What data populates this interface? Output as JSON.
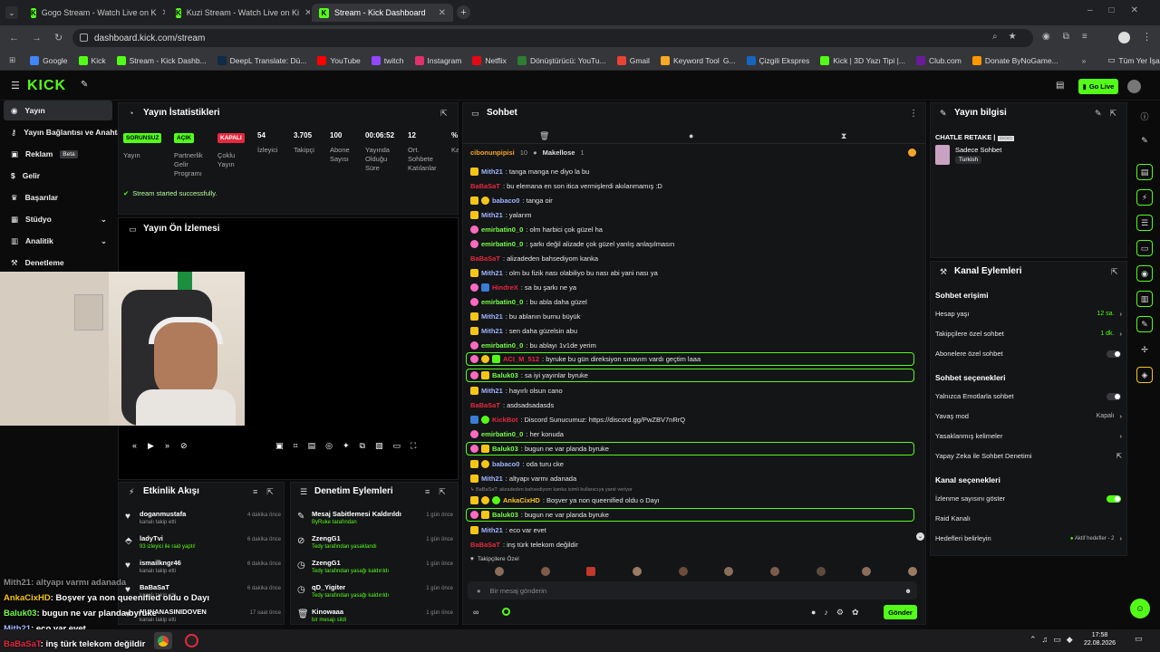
{
  "browser": {
    "tabs": [
      {
        "title": "Gogo Stream - Watch Live on K"
      },
      {
        "title": "Kuzi Stream - Watch Live on Ki"
      },
      {
        "title": "Stream - Kick Dashboard"
      }
    ],
    "url": "dashboard.kick.com/stream",
    "bookmarks": [
      "Google",
      "Kick",
      "Stream - Kick Dashb...",
      "DeepL Translate: Dü...",
      "YouTube",
      "twitch",
      "Instagram",
      "Netflix",
      "Dönüştürücü: YouTu...",
      "Gmail",
      "Keyword Tool",
      "G...",
      "Çizgili Ekspres",
      "Kick | 3D Yazı Tipi |...",
      "Club.com",
      "Donate ByNoGame..."
    ],
    "all_bookmarks": "Tüm Yer İşaretleri"
  },
  "header": {
    "logo": "KICK",
    "go_live": "Go Live"
  },
  "sidebar": {
    "items": [
      {
        "label": "Yayın"
      },
      {
        "label": "Yayın Bağlantısı ve Anahtarı"
      },
      {
        "label": "Reklam",
        "badge": "Beta"
      },
      {
        "label": "Gelir"
      },
      {
        "label": "Başarılar"
      },
      {
        "label": "Stüdyo"
      },
      {
        "label": "Analitik"
      },
      {
        "label": "Denetleme"
      }
    ]
  },
  "stats": {
    "title": "Yayın İstatistikleri",
    "badges": [
      {
        "text": "SORUNSUZ",
        "label": "Yayın",
        "color": "#53fc18"
      },
      {
        "text": "AÇIK",
        "label": "Partnerlik Gelir Programı",
        "color": "#53fc18"
      },
      {
        "text": "KAPALI",
        "label": "Çoklu Yayın",
        "color": "#e5293f"
      }
    ],
    "values": [
      {
        "value": "54",
        "label": "İzleyici"
      },
      {
        "value": "3.705",
        "label": "Takipçi"
      },
      {
        "value": "100",
        "label": "Abone Sayısı"
      },
      {
        "value": "00:06:52",
        "label": "Yayında Olduğu Süre"
      },
      {
        "value": "12",
        "label": "Ort. Sohbete Katılanlar"
      },
      {
        "value": "%",
        "label": "Ka"
      }
    ],
    "success": "Stream started successfully."
  },
  "preview": {
    "title": "Yayın Ön İzlemesi"
  },
  "activity": {
    "title": "Etkinlik Akışı",
    "rows": [
      {
        "name": "doganmustafa",
        "sub": "kanalı takip etti",
        "time": "4 dakika önce"
      },
      {
        "name": "ladyTvi",
        "sub": "93 izleyici ile raid yaptı!",
        "time": "6 dakika önce"
      },
      {
        "name": "ismailkngr46",
        "sub": "kanalı takip etti",
        "time": "6 dakika önce"
      },
      {
        "name": "BaBaSaT",
        "sub": "kanalı takip etti",
        "time": "6 dakika önce"
      },
      {
        "name": "NUNANASINIDOVEN",
        "sub": "kanalı takip etti",
        "time": "17 saat önce"
      }
    ]
  },
  "moderation": {
    "title": "Denetim Eylemleri",
    "rows": [
      {
        "name": "Mesaj Sabitlemesi Kaldırıldı",
        "sub": "ByRuke tarafından",
        "time": "1 gün önce"
      },
      {
        "name": "ZzengG1",
        "sub": "Tedy tarafından yasaklandı",
        "time": "1 gün önce"
      },
      {
        "name": "ZzengG1",
        "sub": "Tedy tarafından yasağı kaldırıldı",
        "time": "1 gün önce"
      },
      {
        "name": "qD_Yigiter",
        "sub": "Tedy tarafından yasağı kaldırıldı",
        "time": "1 gün önce"
      },
      {
        "name": "Kinowaaa",
        "sub": "bir mesajı sildi",
        "time": "1 gün önce"
      }
    ]
  },
  "chat": {
    "title": "Sohbet",
    "pinned": {
      "user1": "cibonunpipisi",
      "count1": "10",
      "user2": "Makellose",
      "count2": "1"
    },
    "messages": [
      {
        "user": "Mith21",
        "text": ": tanga manga ne diyo la bu",
        "color": "#9fb4ff"
      },
      {
        "user": "BaBaSaT",
        "text": ": bu elemana en son itica vermişlerdi akılanmamış :D",
        "color": "#e5293f"
      },
      {
        "user": "babaco0",
        "text": ": tanga oir",
        "color": "#9fb4ff"
      },
      {
        "user": "Mith21",
        "text": ": yalarım",
        "color": "#9fb4ff"
      },
      {
        "user": "emirbatin0_0",
        "text": ": olm harbici çok güzel ha",
        "color": "#75fd46"
      },
      {
        "user": "emirbatin0_0",
        "text": ": şarkı değil alizade çok güzel yanlış anlaşılmasın",
        "color": "#75fd46"
      },
      {
        "user": "BaBaSaT",
        "text": ": alizadeden bahsediyom kanka",
        "color": "#e5293f"
      },
      {
        "user": "Mith21",
        "text": ": olm bu fizik nası olabiliyo bu nası abi yani nası ya",
        "color": "#9fb4ff"
      },
      {
        "user": "HindreX",
        "text": ": sa bu şarkı ne ya",
        "color": "#e5293f"
      },
      {
        "user": "emirbatin0_0",
        "text": ": bu abla daha güzel",
        "color": "#75fd46"
      },
      {
        "user": "Mith21",
        "text": ": bu ablanın burnu büyük",
        "color": "#9fb4ff"
      },
      {
        "user": "Mith21",
        "text": ": sen daha güzelsin abu",
        "color": "#9fb4ff"
      },
      {
        "user": "emirbatin0_0",
        "text": ": bu ablayı 1v1de yerim",
        "color": "#75fd46"
      },
      {
        "user": "ACI_M_512",
        "text": ": byruke bu gün direksiyon sınavım vardı geçtim laaa",
        "color": "#e5293f"
      },
      {
        "user": "Baluk03",
        "text": ": sa iyi yayınlar byruke",
        "color": "#75fd46"
      },
      {
        "user": "Mith21",
        "text": ": hayırlı olsun cano",
        "color": "#9fb4ff"
      },
      {
        "user": "BaBaSaT",
        "text": ": asdsadsadasds",
        "color": "#e5293f"
      },
      {
        "user": "KickBot",
        "text": ": Discord Sunucumuz: https://discord.gg/PwZBV7nRrQ",
        "color": "#e5293f"
      },
      {
        "user": "emirbatin0_0",
        "text": ": her konuda",
        "color": "#75fd46"
      },
      {
        "user": "Baluk03",
        "text": ": bugun ne var planda byruke",
        "color": "#75fd46"
      },
      {
        "user": "babaco0",
        "text": ": oda turu cke",
        "color": "#9fb4ff"
      },
      {
        "user": "Mith21",
        "text": ": altyapı varmı adanada",
        "color": "#9fb4ff"
      },
      {
        "user": "AnkaCixHD",
        "text": ": Boşver ya non queenified oldu o Dayı",
        "color": "#f5c518"
      },
      {
        "user": "Baluk03",
        "text": ": bugun ne var planda byruke",
        "color": "#75fd46"
      },
      {
        "user": "Mith21",
        "text": ": eco var evet",
        "color": "#9fb4ff"
      },
      {
        "user": "BaBaSaT",
        "text": ": inş türk telekom değildir",
        "color": "#e5293f"
      }
    ],
    "reply_hint": "BaBaSaT: alizadeden bahsediyom kanka isimli kullanıcıya yanıt veriyor",
    "followers_only": "Takipçilere Özel",
    "placeholder": "Bir mesaj gönderin",
    "send": "Gönder"
  },
  "info": {
    "title": "Yayın bilgisi",
    "stream_title": "CHATLE RETAKE |",
    "category": "Sadece Sohbet",
    "tag": "Turkish"
  },
  "channel": {
    "title": "Kanal Eylemleri",
    "chat_access": "Sohbet erişimi",
    "account_age": {
      "label": "Hesap yaşı",
      "value": "12 sa."
    },
    "followers_chat": {
      "label": "Takipçilere özel sohbet",
      "value": "1 dk."
    },
    "subs_chat": "Abonelere özel sohbet",
    "chat_options": "Sohbet seçenekleri",
    "emote_only": "Yalnızca Emotlarla sohbet",
    "slow_mode": {
      "label": "Yavaş mod",
      "value": "Kapalı"
    },
    "banned_words": "Yasaklanmış kelimeler",
    "ai_mod": "Yapay Zeka ile Sohbet Denetimi",
    "channel_options": "Kanal seçenekleri",
    "show_viewers": "İzlenme sayısını göster",
    "raid_channel": "Raid Kanalı",
    "set_goals": {
      "label": "Hedefleri belirleyin",
      "value": "Aktif hedefler - 2"
    }
  },
  "overlay": [
    {
      "user": "Mith21",
      "text": ": altyapı varmı adanada",
      "color": "#9a9a9a"
    },
    {
      "user": "AnkaCixHD",
      "text": ": Boşver ya non queenified oldu o Dayı",
      "color": "#f5c518"
    },
    {
      "user": "Baluk03",
      "text": ": bugun ne var planda byruke",
      "color": "#75fd46"
    },
    {
      "user": "Mith21",
      "text": ": eco var evet",
      "color": "#9fb4ff"
    },
    {
      "user": "BaBaSaT",
      "text": ": inş türk telekom değildir",
      "color": "#e5293f"
    }
  ],
  "taskbar": {
    "time": "17:58",
    "date": "22.08.2026"
  }
}
